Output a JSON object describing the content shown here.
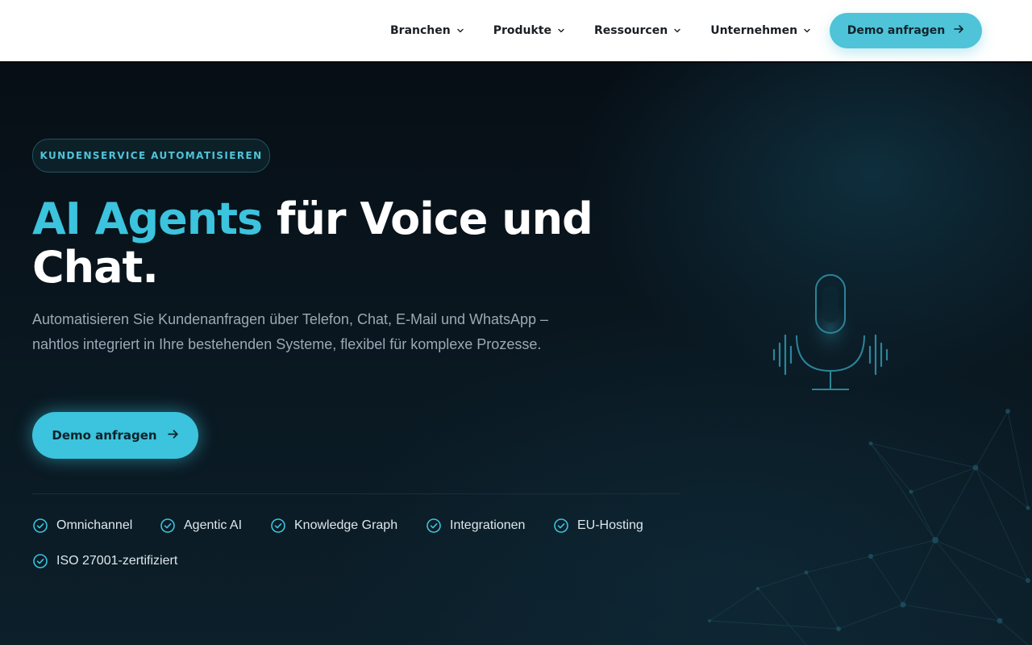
{
  "header": {
    "nav": [
      {
        "label": "Branchen"
      },
      {
        "label": "Produkte"
      },
      {
        "label": "Ressourcen"
      },
      {
        "label": "Unternehmen"
      }
    ],
    "cta_label": "Demo anfragen"
  },
  "hero": {
    "eyebrow": "KUNDENSERVICE AUTOMATISIEREN",
    "headline_accent": "AI Agents",
    "headline_rest": " für Voice und Chat.",
    "subtext": "Automatisieren Sie Kundenanfragen über Telefon, Chat, E-Mail und WhatsApp – nahtlos integriert in Ihre bestehenden Systeme, flexibel für komplexe Prozesse.",
    "cta_label": "Demo anfragen",
    "features": [
      {
        "label": "Omnichannel"
      },
      {
        "label": "Agentic AI"
      },
      {
        "label": "Knowledge Graph"
      },
      {
        "label": "Integrationen"
      },
      {
        "label": "EU-Hosting"
      },
      {
        "label": "ISO 27001-zertifiziert"
      }
    ]
  },
  "colors": {
    "accent": "#3cc3dd",
    "header_cta": "#4fc3d8",
    "background": "#08121a",
    "text_muted": "#9aa9b4"
  },
  "icons": {
    "nav_dropdown": "chevron-down-icon",
    "cta": "arrow-right-icon",
    "feature": "check-circle-icon",
    "illustration": "microphone-icon"
  }
}
